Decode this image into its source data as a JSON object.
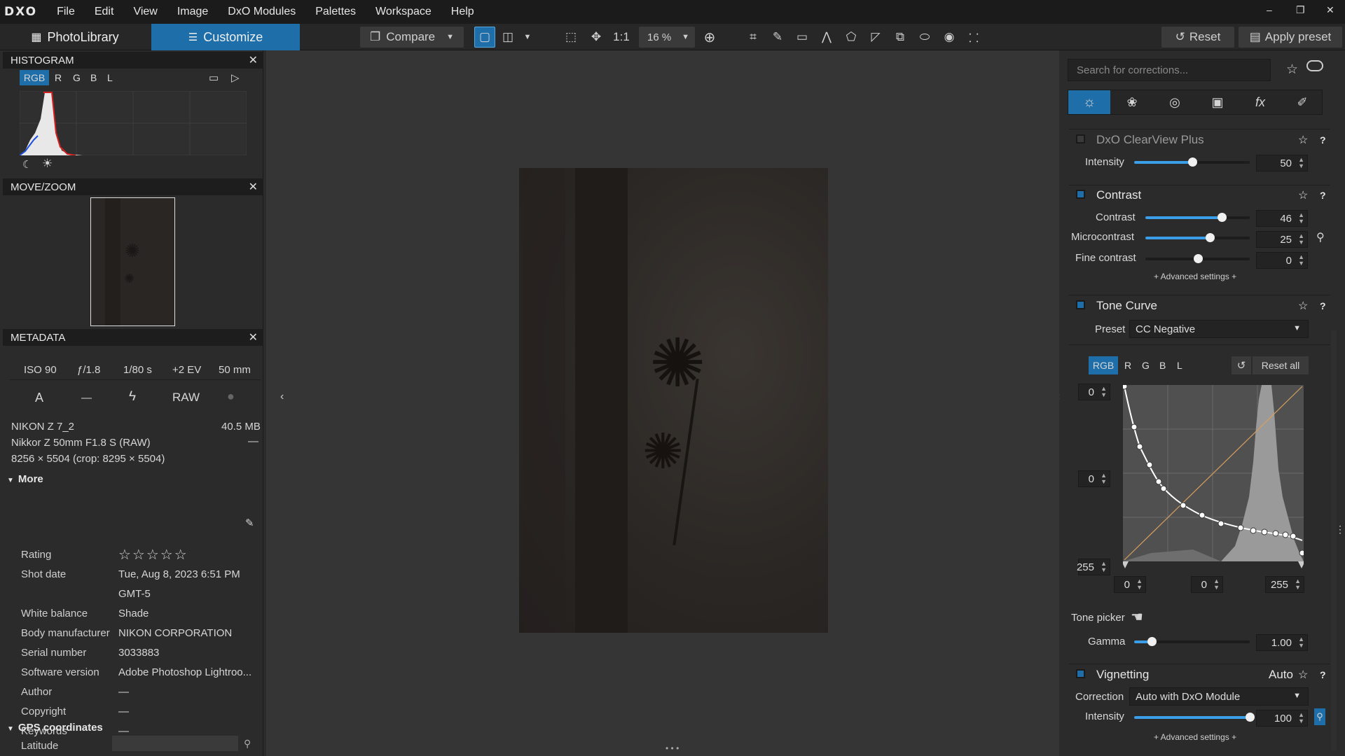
{
  "menu": {
    "logo": "DXO",
    "items": [
      "File",
      "Edit",
      "View",
      "Image",
      "DxO Modules",
      "Palettes",
      "Workspace",
      "Help"
    ]
  },
  "window": {
    "minimize": "–",
    "restore": "❐",
    "close": "✕"
  },
  "toolbar": {
    "photolibrary": "PhotoLibrary",
    "customize": "Customize",
    "compare": "Compare",
    "one_to_one": "1:1",
    "zoom": "16 %",
    "reset": "Reset",
    "apply_preset": "Apply preset"
  },
  "histogram": {
    "title": "HISTOGRAM",
    "channels": [
      "RGB",
      "R",
      "G",
      "B",
      "L"
    ]
  },
  "movezoom": {
    "title": "MOVE/ZOOM"
  },
  "metadata": {
    "title": "METADATA",
    "iso": "ISO 90",
    "aperture": "ƒ/1.8",
    "shutter": "1/80 s",
    "ev": "+2 EV",
    "focal": "50 mm",
    "mode": "A",
    "dash": "—",
    "raw": "RAW",
    "camera": "NIKON Z 7_2",
    "size": "40.5 MB",
    "lens": "Nikkor Z 50mm F1.8 S (RAW)",
    "dims": "8256 × 5504  (crop: 8295 × 5504)",
    "more": "More",
    "rows": [
      {
        "label": "Rating",
        "value": "☆☆☆☆☆"
      },
      {
        "label": "Shot date",
        "value": "Tue, Aug 8, 2023 6:51 PM"
      },
      {
        "label": "",
        "value": "GMT-5"
      },
      {
        "label": "White balance",
        "value": "Shade"
      },
      {
        "label": "Body manufacturer",
        "value": "NIKON CORPORATION"
      },
      {
        "label": "Serial number",
        "value": "3033883"
      },
      {
        "label": "Software version",
        "value": "Adobe Photoshop Lightroo..."
      },
      {
        "label": "Author",
        "value": "—"
      },
      {
        "label": "Copyright",
        "value": "—"
      },
      {
        "label": "Keywords",
        "value": "—"
      }
    ],
    "gps": "GPS coordinates",
    "latitude": "Latitude"
  },
  "right": {
    "search_placeholder": "Search for corrections...",
    "clearview": {
      "title": "DxO ClearView Plus",
      "intensity_label": "Intensity",
      "intensity": "50",
      "intensity_frac": 0.5
    },
    "contrast": {
      "title": "Contrast",
      "contrast_label": "Contrast",
      "contrast": "46",
      "contrast_frac": 0.73,
      "micro_label": "Microcontrast",
      "micro": "25",
      "micro_frac": 0.62,
      "fine_label": "Fine contrast",
      "fine": "0",
      "fine_frac": 0.5,
      "advanced": "+ Advanced settings +"
    },
    "tonecurve": {
      "title": "Tone Curve",
      "preset_label": "Preset",
      "preset": "CC Negative",
      "channels": [
        "RGB",
        "R",
        "G",
        "B",
        "L"
      ],
      "reset_all": "Reset all",
      "out_top": "0",
      "out_mid": "0",
      "out_bottom": "255",
      "in_left": "0",
      "in_mid": "0",
      "in_right": "255",
      "tone_picker": "Tone picker",
      "gamma_label": "Gamma",
      "gamma": "1.00",
      "gamma_frac": 0.15
    },
    "vignetting": {
      "title": "Vignetting",
      "auto": "Auto",
      "correction_label": "Correction",
      "correction": "Auto with DxO Module",
      "intensity_label": "Intensity",
      "intensity": "100",
      "intensity_frac": 1.0,
      "advanced": "+ Advanced settings +"
    }
  },
  "colors": {
    "accent": "#1e6fa9",
    "slider": "#3a9ee8"
  }
}
